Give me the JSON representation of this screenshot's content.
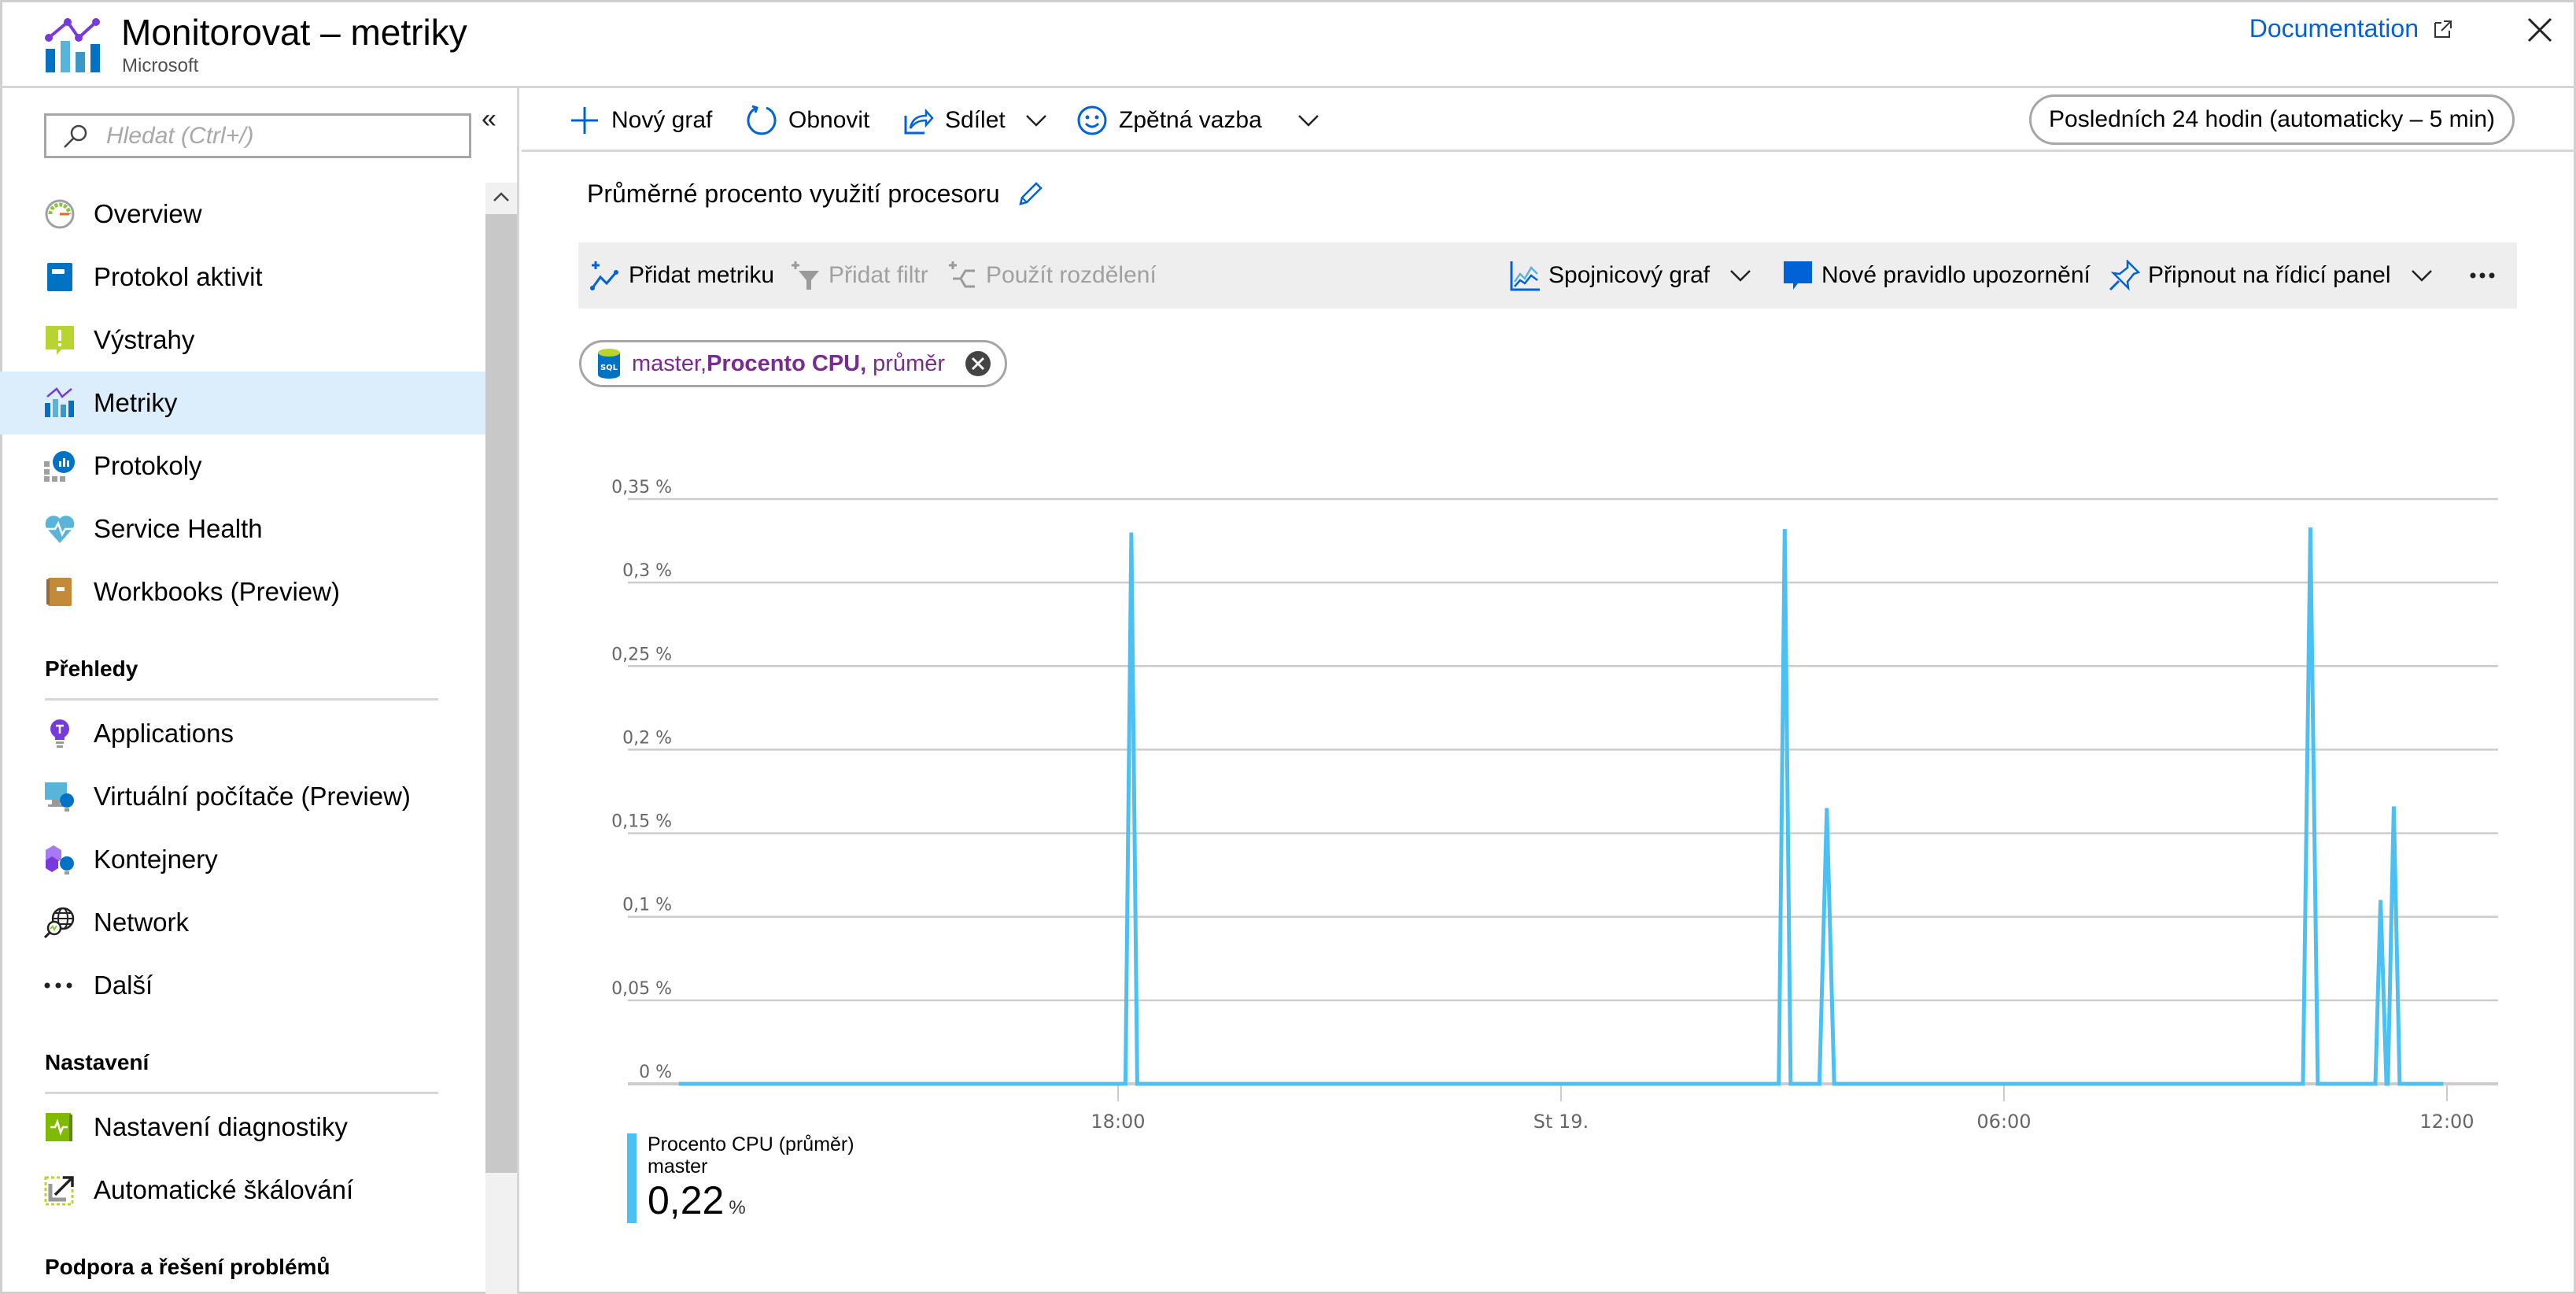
{
  "header": {
    "title": "Monitorovat – metriky",
    "subtitle": "Microsoft",
    "documentation_link": "Documentation"
  },
  "sidebar": {
    "search_placeholder": "Hledat (Ctrl+/)",
    "items": [
      {
        "label": "Overview",
        "icon": "gauge-icon"
      },
      {
        "label": "Protokol aktivit",
        "icon": "activity-log-icon"
      },
      {
        "label": "Výstrahy",
        "icon": "alert-icon"
      },
      {
        "label": "Metriky",
        "icon": "metrics-icon",
        "active": true
      },
      {
        "label": "Protokoly",
        "icon": "logs-icon"
      },
      {
        "label": "Service Health",
        "icon": "heart-pulse-icon"
      },
      {
        "label": "Workbooks (Preview)",
        "icon": "workbook-icon"
      }
    ],
    "sections": [
      {
        "title": "Přehledy",
        "items": [
          {
            "label": "Applications",
            "icon": "lightbulb-icon"
          },
          {
            "label": "Virtuální počítače (Preview)",
            "icon": "vm-insights-icon"
          },
          {
            "label": "Kontejnery",
            "icon": "container-insights-icon"
          },
          {
            "label": "Network",
            "icon": "network-globe-icon"
          },
          {
            "label": "Další",
            "icon": "more-icon"
          }
        ]
      },
      {
        "title": "Nastavení",
        "items": [
          {
            "label": "Nastavení diagnostiky",
            "icon": "diagnostics-icon"
          },
          {
            "label": "Automatické škálování",
            "icon": "autoscale-icon"
          }
        ]
      },
      {
        "title": "Podpora a řešení problémů",
        "items": []
      }
    ]
  },
  "commandbar": {
    "new_chart": "Nový graf",
    "refresh": "Obnovit",
    "share": "Sdílet",
    "feedback": "Zpětná vazba",
    "time_range": "Posledních 24 hodin (automaticky – 5 min)"
  },
  "chart_panel": {
    "title": "Průměrné procento využití procesoru",
    "toolbar": {
      "add_metric": "Přidat metriku",
      "add_filter": "Přidat filtr",
      "apply_splitting": "Použít rozdělení",
      "chart_type": "Spojnicový graf",
      "new_alert_rule": "Nové pravidlo upozornění",
      "pin_to_dashboard": "Připnout na řídicí panel"
    },
    "metric_pill": {
      "resource": "master,",
      "metric": "Procento CPU,",
      "aggregation": " průměr"
    },
    "legend": {
      "series_name": "Procento CPU (průměr)",
      "resource": "master",
      "value": "0,22",
      "unit": "%"
    }
  },
  "colors": {
    "accent": "#0062d6",
    "series": "#4cc0f3",
    "metric_pill_text": "#7a2b8f",
    "active_nav_bg": "#dcedfc"
  },
  "chart_data": {
    "type": "line",
    "title": "Průměrné procento využití procesoru",
    "xlabel": "",
    "ylabel": "",
    "x_unit": "hours relative to 18:00 (day before St 19.)",
    "xlim": [
      -6.0,
      18.0
    ],
    "ylim": [
      0,
      0.35
    ],
    "grid": true,
    "x_ticks": [
      {
        "at": 0,
        "label": "18:00"
      },
      {
        "at": 6,
        "label": "St 19."
      },
      {
        "at": 12,
        "label": "06:00"
      },
      {
        "at": 18,
        "label": "12:00"
      }
    ],
    "y_ticks": [
      {
        "at": 0,
        "label": "0 %"
      },
      {
        "at": 0.05,
        "label": "0,05 %"
      },
      {
        "at": 0.1,
        "label": "0,1 %"
      },
      {
        "at": 0.15,
        "label": "0,15 %"
      },
      {
        "at": 0.2,
        "label": "0,2 %"
      },
      {
        "at": 0.25,
        "label": "0,25 %"
      },
      {
        "at": 0.3,
        "label": "0,3 %"
      },
      {
        "at": 0.35,
        "label": "0,35 %"
      }
    ],
    "legend_position": "bottom-left",
    "series": [
      {
        "name": "Procento CPU (průměr) – master",
        "color": "#4cc0f3",
        "points": [
          [
            -5.95,
            0
          ],
          [
            0.1,
            0
          ],
          [
            0.18,
            0.33
          ],
          [
            0.26,
            0
          ],
          [
            8.95,
            0
          ],
          [
            9.03,
            0.332
          ],
          [
            9.11,
            0
          ],
          [
            9.5,
            0
          ],
          [
            9.6,
            0.165
          ],
          [
            9.7,
            0
          ],
          [
            16.05,
            0
          ],
          [
            16.15,
            0.333
          ],
          [
            16.25,
            0
          ],
          [
            17.03,
            0
          ],
          [
            17.1,
            0.11
          ],
          [
            17.18,
            0
          ],
          [
            17.2,
            0
          ],
          [
            17.28,
            0.166
          ],
          [
            17.36,
            0
          ],
          [
            17.95,
            0
          ]
        ]
      }
    ]
  }
}
